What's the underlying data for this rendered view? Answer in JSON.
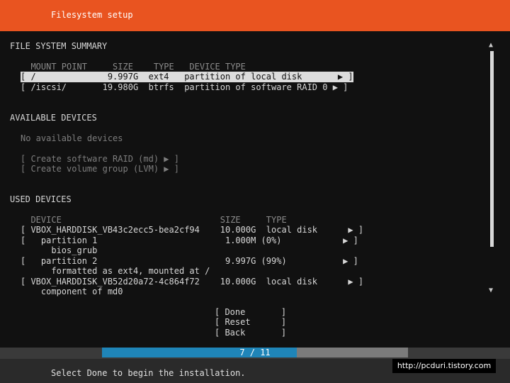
{
  "header": {
    "title": "Filesystem setup"
  },
  "filesystem_summary": {
    "heading": "FILE SYSTEM SUMMARY",
    "columns": "  MOUNT POINT     SIZE    TYPE   DEVICE TYPE",
    "rows": [
      "[ /              9.997G  ext4   partition of local disk       ▶ ]",
      "[ /iscsi/       19.980G  btrfs  partition of software RAID 0 ▶ ]"
    ]
  },
  "available_devices": {
    "heading": "AVAILABLE DEVICES",
    "empty_text": "No available devices",
    "create_raid": "[ Create software RAID (md) ▶ ]",
    "create_lvm": "[ Create volume group (LVM) ▶ ]"
  },
  "used_devices": {
    "heading": "USED DEVICES",
    "columns": "  DEVICE                               SIZE     TYPE",
    "rows": [
      "[ VBOX_HARDDISK_VB43c2ecc5-bea2cf94    10.000G  local disk      ▶ ]",
      "[   partition 1                         1.000M (0%)            ▶ ]",
      "      bios_grub",
      "[   partition 2                         9.997G (99%)           ▶ ]",
      "      formatted as ext4, mounted at /",
      "[ VBOX_HARDDISK_VB52d20a72-4c864f72    10.000G  local disk      ▶ ]",
      "    component of md0"
    ]
  },
  "buttons": {
    "done": "[ Done       ]",
    "reset": "[ Reset      ]",
    "back": "[ Back       ]"
  },
  "progress": {
    "text": "7 / 11",
    "current": 7,
    "total": 11
  },
  "footer": {
    "text": "Select Done to begin the installation."
  },
  "watermark": "http://pcduri.tistory.com",
  "colors": {
    "header": "#e95420",
    "progress_fill": "#1f85b8",
    "panel": "#111111"
  },
  "icons": {
    "scroll_up": "▲",
    "scroll_down": "▼"
  }
}
